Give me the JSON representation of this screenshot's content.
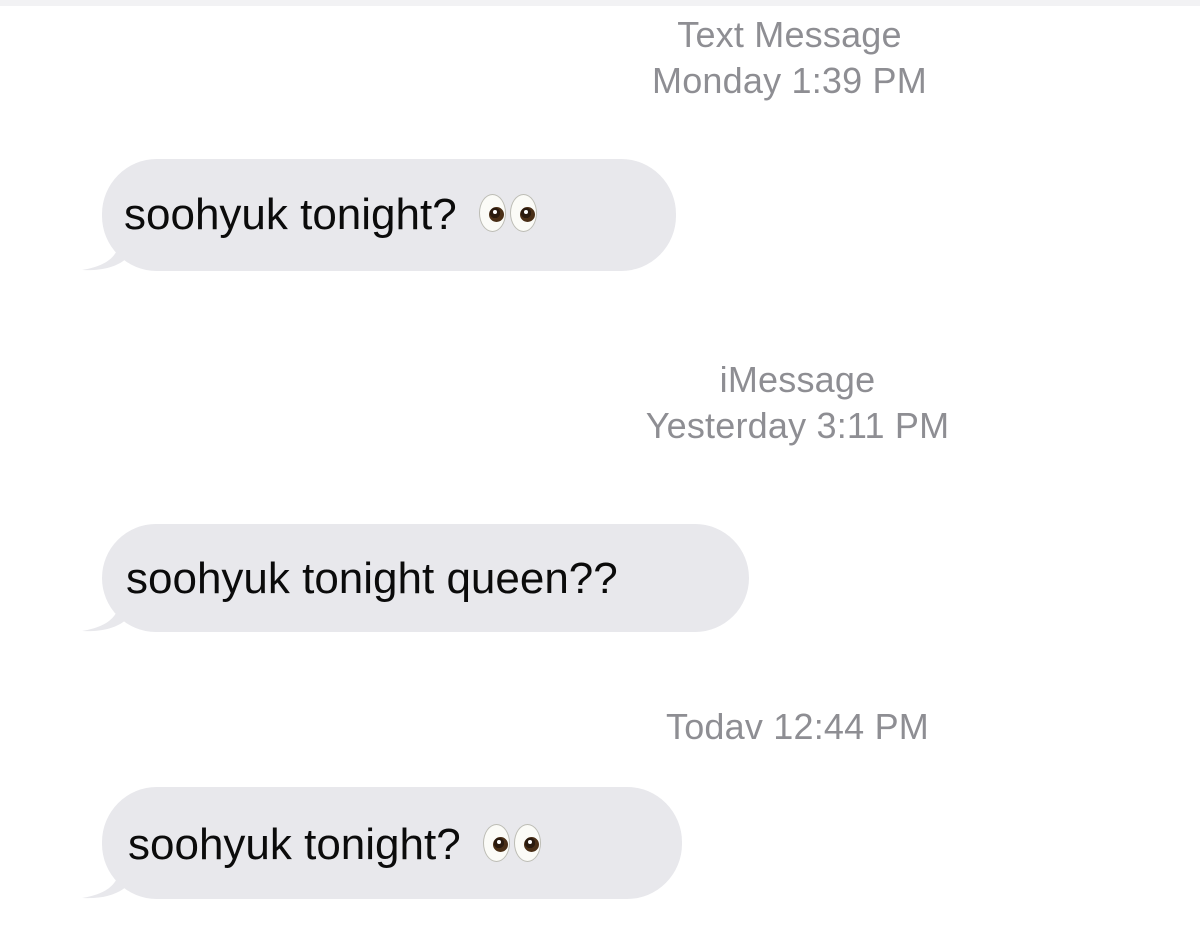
{
  "thread": {
    "groups": [
      {
        "service": "Text Message",
        "timestamp": "Monday 1:39 PM",
        "message": {
          "text": "soohyuk tonight?",
          "emoji": "eyes-emoji"
        }
      },
      {
        "service": "iMessage",
        "timestamp": "Yesterday 3:11 PM",
        "message": {
          "text": "soohyuk tonight queen??",
          "emoji": ""
        }
      },
      {
        "service": "",
        "timestamp": "Todav 12:44 PM",
        "message": {
          "text": "soohyuk tonight?",
          "emoji": "eyes-emoji"
        }
      }
    ]
  },
  "colors": {
    "background": "#ffffff",
    "incoming_bubble": "#e8e8ec",
    "timestamp_text": "#8e8e93",
    "message_text": "#0b0b0b"
  }
}
